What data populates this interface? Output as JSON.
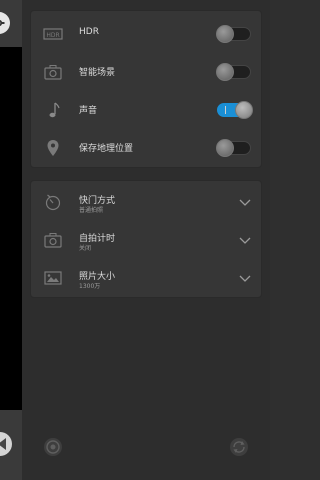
{
  "settings_card": {
    "rows": [
      {
        "label": "HDR",
        "icon": "hdr-icon",
        "toggle_state": "off"
      },
      {
        "label": "智能场景",
        "icon": "smart-scene-camera-icon",
        "toggle_state": "off"
      },
      {
        "label": "声音",
        "icon": "music-note-icon",
        "toggle_state": "on"
      },
      {
        "label": "保存地理位置",
        "icon": "location-pin-icon",
        "toggle_state": "off"
      }
    ]
  },
  "options_card": {
    "rows": [
      {
        "label": "快门方式",
        "value": "普通拍照",
        "icon": "shutter-timer-icon"
      },
      {
        "label": "自拍计时",
        "value": "关闭",
        "icon": "self-timer-camera-icon"
      },
      {
        "label": "照片大小",
        "value": "1300万",
        "icon": "photo-size-icon"
      }
    ]
  },
  "colors": {
    "toggle_on": "#1a8fd6",
    "panel_bg": "#2d2d2d",
    "card_bg": "#363636"
  }
}
